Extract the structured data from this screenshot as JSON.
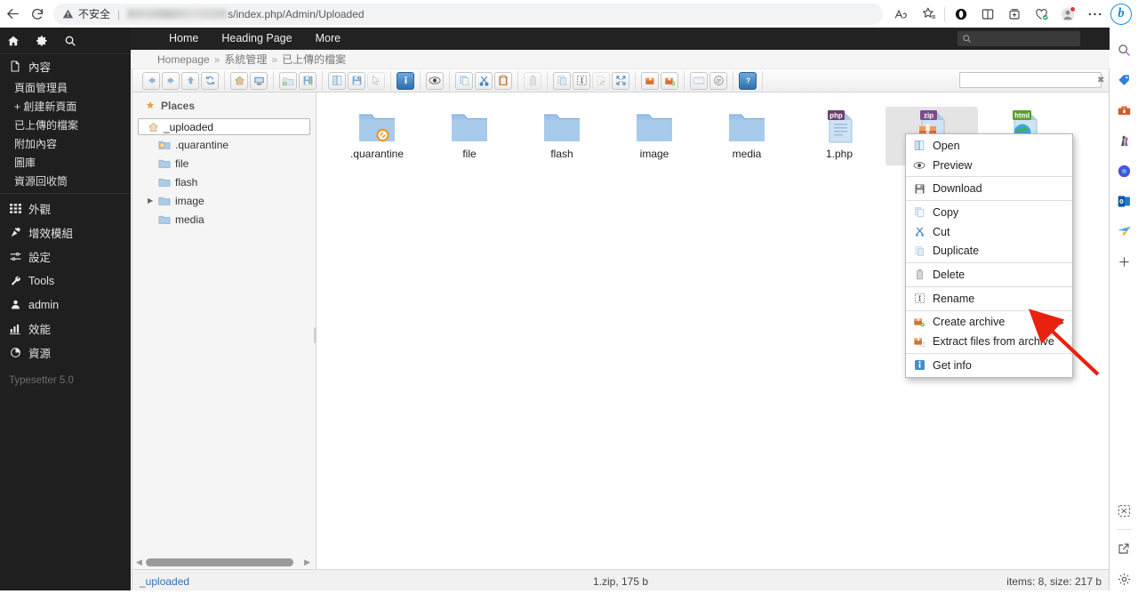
{
  "browser": {
    "back_icon": "back-arrow-icon",
    "reload_icon": "reload-icon",
    "security_label": "不安全",
    "url_suffix": "s/index.php/Admin/Uploaded",
    "toolbar_icons": [
      {
        "name": "read-aloud-icon",
        "glyph": "A"
      },
      {
        "name": "favorite-star-icon",
        "glyph": "★"
      },
      {
        "name": "opera-circle-icon",
        "glyph": "●"
      },
      {
        "name": "split-screen-icon",
        "glyph": "⊞"
      },
      {
        "name": "collections-icon",
        "glyph": "❏"
      },
      {
        "name": "browser-essentials-icon",
        "glyph": "❤"
      },
      {
        "name": "profile-avatar-icon",
        "glyph": "●"
      },
      {
        "name": "settings-more-icon",
        "glyph": "⋯"
      },
      {
        "name": "bing-copilot-icon",
        "glyph": "b"
      }
    ]
  },
  "admin_sidebar": {
    "top_icons": [
      {
        "name": "home-icon",
        "glyph": "⌂"
      },
      {
        "name": "gear-icon",
        "glyph": "⚙"
      },
      {
        "name": "search-icon",
        "glyph": "🔍"
      }
    ],
    "sections": [
      {
        "label": "內容",
        "icon": "document-icon",
        "children": [
          "頁面管理員",
          "+ 創建新頁面",
          "已上傳的檔案",
          "附加內容",
          "圖庫",
          "資源回收筒"
        ]
      }
    ],
    "items": [
      {
        "label": "外觀",
        "icon": "grid-icon"
      },
      {
        "label": "增效模組",
        "icon": "plug-icon"
      },
      {
        "label": "設定",
        "icon": "sliders-icon"
      },
      {
        "label": "Tools",
        "icon": "wrench-icon"
      },
      {
        "label": "admin",
        "icon": "user-icon"
      },
      {
        "label": "效能",
        "icon": "chart-icon"
      },
      {
        "label": "資源",
        "icon": "pie-icon"
      }
    ],
    "version": "Typesetter 5.0"
  },
  "right_rail": {
    "icons": [
      {
        "name": "search-magnifier-icon"
      },
      {
        "name": "shopping-tag-icon"
      },
      {
        "name": "toolbox-icon"
      },
      {
        "name": "games-icon"
      },
      {
        "name": "microsoft-365-icon"
      },
      {
        "name": "outlook-icon"
      },
      {
        "name": "paper-plane-icon"
      },
      {
        "name": "add-plus-icon"
      },
      {
        "name": "customize-icon"
      },
      {
        "name": "open-external-icon"
      },
      {
        "name": "settings-gear-icon"
      }
    ]
  },
  "site_nav": {
    "links": [
      "Home",
      "Heading Page",
      "More"
    ],
    "search_placeholder": ""
  },
  "breadcrumb": {
    "items": [
      "Homepage",
      "系統管理",
      "已上傳的檔案"
    ],
    "separator": "»"
  },
  "filemanager": {
    "toolbar_groups": [
      {
        "buttons": [
          {
            "name": "back-button",
            "glyph": "←",
            "disabled": false
          },
          {
            "name": "forward-button",
            "glyph": "→",
            "disabled": false
          },
          {
            "name": "up-button",
            "glyph": "↑",
            "disabled": false
          },
          {
            "name": "reload-button",
            "glyph": "⟳",
            "disabled": false
          }
        ]
      },
      {
        "buttons": [
          {
            "name": "home-button",
            "glyph": "⌂",
            "disabled": false
          },
          {
            "name": "netmount-button",
            "glyph": "▭",
            "disabled": false
          }
        ]
      },
      {
        "buttons": [
          {
            "name": "new-folder-button",
            "glyph": "▣",
            "disabled": false
          },
          {
            "name": "new-file-button",
            "glyph": "▤",
            "disabled": false
          }
        ]
      },
      {
        "buttons": [
          {
            "name": "open-button",
            "glyph": "▯",
            "disabled": false
          },
          {
            "name": "download-button",
            "glyph": "▤",
            "disabled": false
          },
          {
            "name": "select-button",
            "glyph": "↖",
            "disabled": true
          }
        ]
      },
      {
        "buttons": [
          {
            "name": "get-info-button",
            "glyph": "i",
            "disabled": false
          }
        ]
      },
      {
        "buttons": [
          {
            "name": "preview-button",
            "glyph": "◉",
            "disabled": false
          }
        ]
      },
      {
        "buttons": [
          {
            "name": "copy-button",
            "glyph": "❐",
            "disabled": false
          },
          {
            "name": "cut-button",
            "glyph": "✂",
            "disabled": false
          },
          {
            "name": "paste-button",
            "glyph": "📋",
            "disabled": false
          }
        ]
      },
      {
        "buttons": [
          {
            "name": "delete-button",
            "glyph": "🗑",
            "disabled": true
          }
        ]
      },
      {
        "buttons": [
          {
            "name": "duplicate-button",
            "glyph": "❑",
            "disabled": false
          },
          {
            "name": "rename-button",
            "glyph": "⌶",
            "disabled": false
          },
          {
            "name": "edit-button",
            "glyph": "✎",
            "disabled": true
          },
          {
            "name": "resize-button",
            "glyph": "⤢",
            "disabled": false
          }
        ]
      },
      {
        "buttons": [
          {
            "name": "archive-button",
            "glyph": "▤",
            "disabled": false
          },
          {
            "name": "extract-button",
            "glyph": "▤",
            "disabled": false
          }
        ]
      },
      {
        "buttons": [
          {
            "name": "view-list-button",
            "glyph": "▭",
            "disabled": false
          },
          {
            "name": "sort-button",
            "glyph": "⇅",
            "disabled": false
          }
        ]
      },
      {
        "buttons": [
          {
            "name": "help-button",
            "glyph": "?",
            "disabled": false
          }
        ]
      }
    ],
    "search_placeholder": "",
    "search_value": "",
    "search_clear_glyph": "✖",
    "places": {
      "title": "Places",
      "root": "_uploaded",
      "tree": [
        {
          "label": ".quarantine",
          "icon": "quarantine-folder-icon",
          "expandable": false
        },
        {
          "label": "file",
          "icon": "folder-icon",
          "expandable": false
        },
        {
          "label": "flash",
          "icon": "folder-icon",
          "expandable": false
        },
        {
          "label": "image",
          "icon": "folder-icon",
          "expandable": true
        },
        {
          "label": "media",
          "icon": "folder-icon",
          "expandable": false
        }
      ]
    },
    "files": [
      {
        "label": ".quarantine",
        "type": "folder-quarantine",
        "selected": false
      },
      {
        "label": "file",
        "type": "folder",
        "selected": false
      },
      {
        "label": "flash",
        "type": "folder",
        "selected": false
      },
      {
        "label": "image",
        "type": "folder",
        "selected": false
      },
      {
        "label": "media",
        "type": "folder",
        "selected": false
      },
      {
        "label": "1.php",
        "type": "php",
        "selected": false
      },
      {
        "label": "",
        "type": "zip",
        "selected": true
      },
      {
        "label": "",
        "type": "html",
        "selected": false
      }
    ],
    "status": {
      "path": "_uploaded",
      "selection": "1.zip, 175 b",
      "summary": "items: 8, size: 217 b"
    }
  },
  "context_menu": {
    "items": [
      {
        "label": "Open",
        "icon": "open-icon",
        "submenu": false,
        "sep_after": false
      },
      {
        "label": "Preview",
        "icon": "eye-icon",
        "submenu": false,
        "sep_after": true
      },
      {
        "label": "Download",
        "icon": "floppy-icon",
        "submenu": false,
        "sep_after": true
      },
      {
        "label": "Copy",
        "icon": "copy-icon",
        "submenu": false,
        "sep_after": false
      },
      {
        "label": "Cut",
        "icon": "scissors-icon",
        "submenu": false,
        "sep_after": false
      },
      {
        "label": "Duplicate",
        "icon": "duplicate-icon",
        "submenu": false,
        "sep_after": true
      },
      {
        "label": "Delete",
        "icon": "trash-icon",
        "submenu": false,
        "sep_after": true
      },
      {
        "label": "Rename",
        "icon": "rename-icon",
        "submenu": false,
        "sep_after": true
      },
      {
        "label": "Create archive",
        "icon": "archive-add-icon",
        "submenu": true,
        "sep_after": false
      },
      {
        "label": "Extract files from archive",
        "icon": "archive-extract-icon",
        "submenu": false,
        "sep_after": true
      },
      {
        "label": "Get info",
        "icon": "info-icon",
        "submenu": false,
        "sep_after": false
      }
    ],
    "submenu_arrow": "▶"
  },
  "annotation": {
    "arrow_color": "#e8220f"
  },
  "colors": {
    "sidebar_bg": "#1f1f1f",
    "nav_bg": "#222222",
    "accent_link": "#3273b5",
    "selection_bg": "#e4e4e4"
  }
}
